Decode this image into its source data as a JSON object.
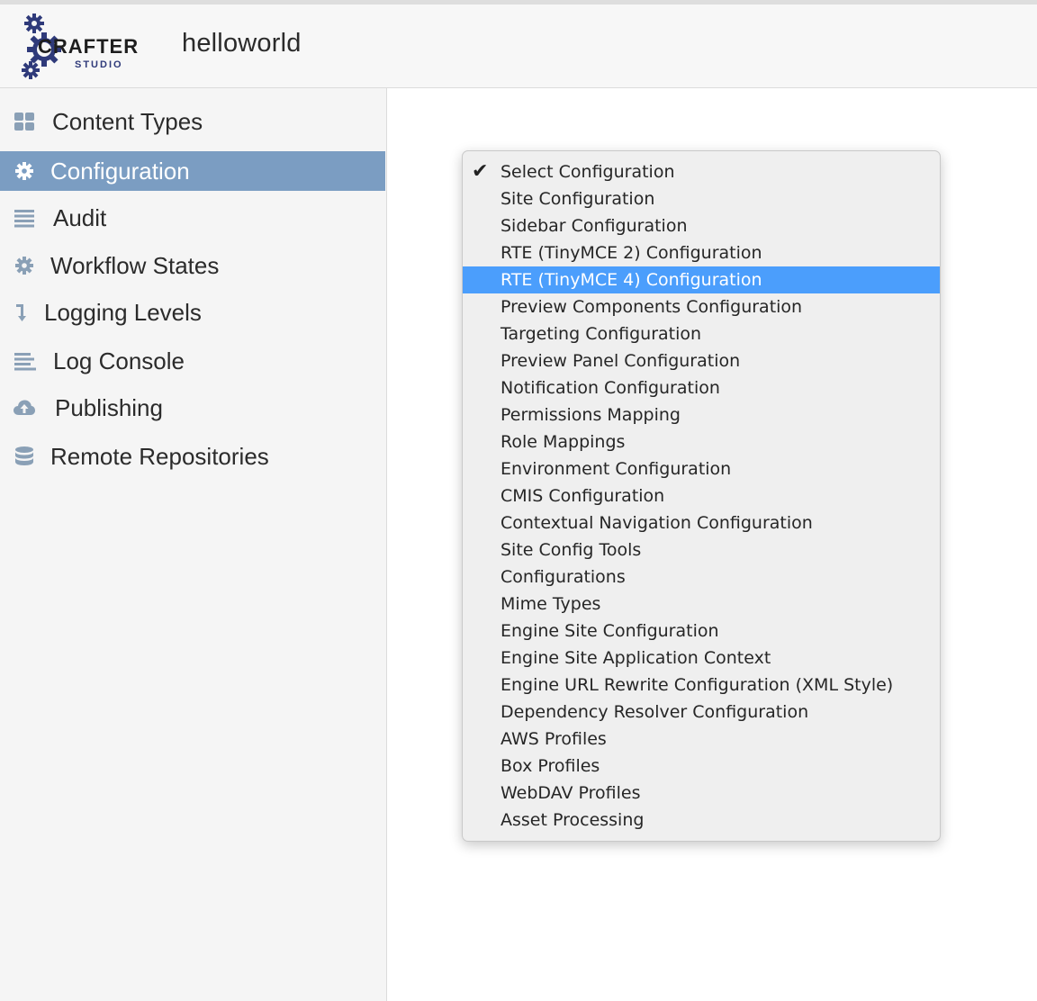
{
  "header": {
    "logo_text": "CRAFTER",
    "logo_subtext": "STUDIO",
    "site_name": "helloworld"
  },
  "sidebar": {
    "items": [
      {
        "label": "Content Types",
        "icon": "grid-icon",
        "active": false
      },
      {
        "label": "Configuration",
        "icon": "gear-icon",
        "active": true
      },
      {
        "label": "Audit",
        "icon": "list-icon",
        "active": false
      },
      {
        "label": "Workflow States",
        "icon": "gear-icon",
        "active": false
      },
      {
        "label": "Logging Levels",
        "icon": "arrow-down-icon",
        "active": false
      },
      {
        "label": "Log Console",
        "icon": "lines-icon",
        "active": false
      },
      {
        "label": "Publishing",
        "icon": "cloud-upload-icon",
        "active": false
      },
      {
        "label": "Remote Repositories",
        "icon": "database-icon",
        "active": false
      }
    ]
  },
  "config_menu": {
    "checked_index": 0,
    "highlighted_index": 4,
    "options": [
      "Select Configuration",
      "Site Configuration",
      "Sidebar Configuration",
      "RTE (TinyMCE 2) Configuration",
      "RTE (TinyMCE 4) Configuration",
      "Preview Components Configuration",
      "Targeting Configuration",
      "Preview Panel Configuration",
      "Notification Configuration",
      "Permissions Mapping",
      "Role Mappings",
      "Environment Configuration",
      "CMIS Configuration",
      "Contextual Navigation Configuration",
      "Site Config Tools",
      "Configurations",
      "Mime Types",
      "Engine Site Configuration",
      "Engine Site Application Context",
      "Engine URL Rewrite Configuration (XML Style)",
      "Dependency Resolver Configuration",
      "AWS Profiles",
      "Box Profiles",
      "WebDAV Profiles",
      "Asset Processing"
    ]
  },
  "colors": {
    "active_nav": "#7b9dc2",
    "highlight": "#4b9efc",
    "icon": "#8aa0b6",
    "logo_gear": "#2f3a7a"
  }
}
